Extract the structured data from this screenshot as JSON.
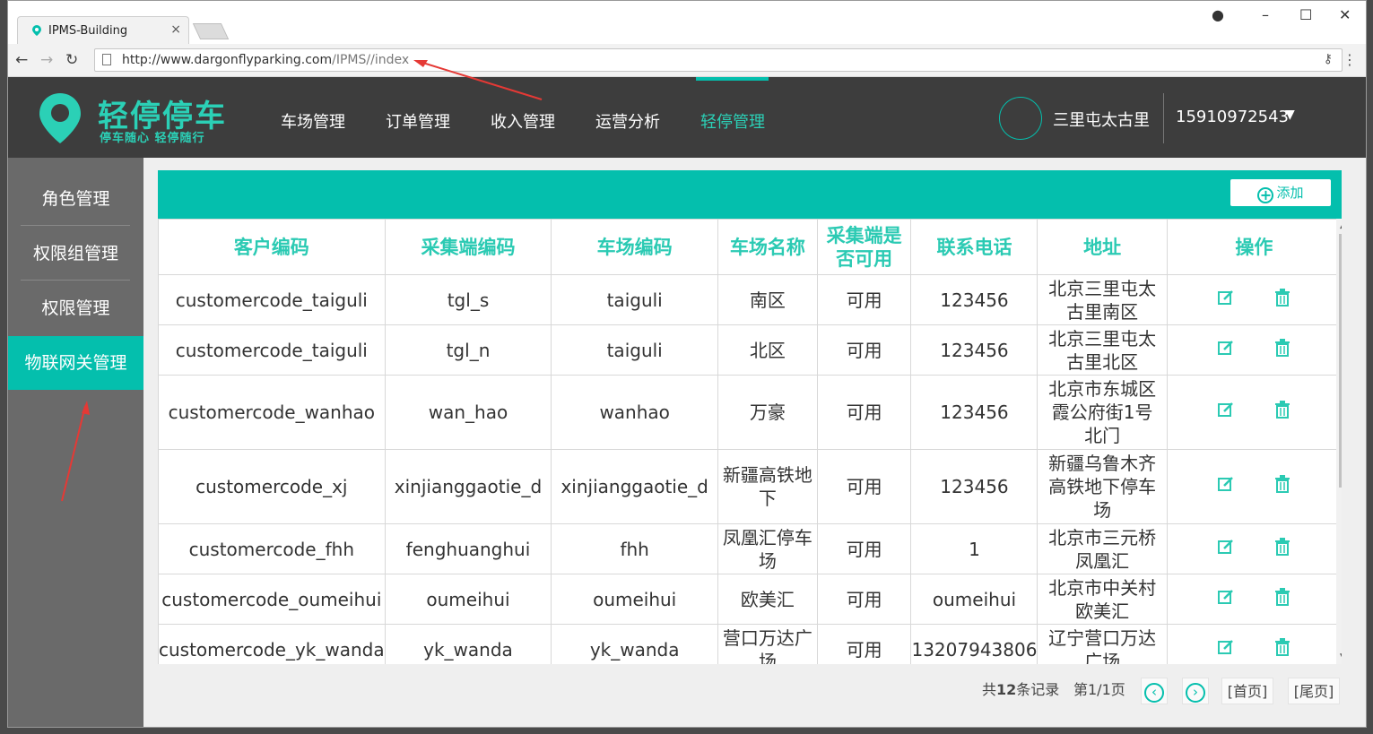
{
  "browser": {
    "tab_title": "IPMS-Building",
    "tab_close": "×",
    "url_host": "http://www.dargonflyparking.com",
    "url_path": "/IPMS//index"
  },
  "header": {
    "logo_title": "轻停停车",
    "logo_slogan": "停车随心 轻停随行",
    "nav": [
      "车场管理",
      "订单管理",
      "收入管理",
      "运营分析",
      "轻停管理"
    ],
    "active_nav_index": 4,
    "location": "三里屯太古里",
    "phone": "15910972543",
    "accent_color": "#04bfad"
  },
  "sidebar": {
    "items": [
      "角色管理",
      "权限组管理",
      "权限管理",
      "物联网关管理"
    ],
    "active_index": 3
  },
  "toolbar": {
    "add_label": "添加"
  },
  "table": {
    "columns": [
      "客户编码",
      "采集端编码",
      "车场编码",
      "车场名称",
      "采集端是否可用",
      "联系电话",
      "地址",
      "操作"
    ],
    "rows": [
      [
        "customercode_taiguli",
        "tgl_s",
        "taiguli",
        "南区",
        "可用",
        "123456",
        "北京三里屯太古里南区"
      ],
      [
        "customercode_taiguli",
        "tgl_n",
        "taiguli",
        "北区",
        "可用",
        "123456",
        "北京三里屯太古里北区"
      ],
      [
        "customercode_wanhao",
        "wan_hao",
        "wanhao",
        "万豪",
        "可用",
        "123456",
        "北京市东城区霞公府街1号北门"
      ],
      [
        "customercode_xj",
        "xinjianggaotie_d",
        "xinjianggaotie_d",
        "新疆高铁地下",
        "可用",
        "123456",
        "新疆乌鲁木齐高铁地下停车场"
      ],
      [
        "customercode_fhh",
        "fenghuanghui",
        "fhh",
        "凤凰汇停车场",
        "可用",
        "1",
        "北京市三元桥凤凰汇"
      ],
      [
        "customercode_oumeihui",
        "oumeihui",
        "oumeihui",
        "欧美汇",
        "可用",
        "oumeihui",
        "北京市中关村欧美汇"
      ],
      [
        "customercode_yk_wanda",
        "yk_wanda",
        "yk_wanda",
        "营口万达广场",
        "可用",
        "13207943806",
        "辽宁营口万达广场"
      ]
    ]
  },
  "pager": {
    "total_prefix": "共",
    "total_count": "12",
    "total_suffix": "条记录",
    "page_info": "第1/1页",
    "first_label": "[首页]",
    "last_label": "[尾页]"
  }
}
